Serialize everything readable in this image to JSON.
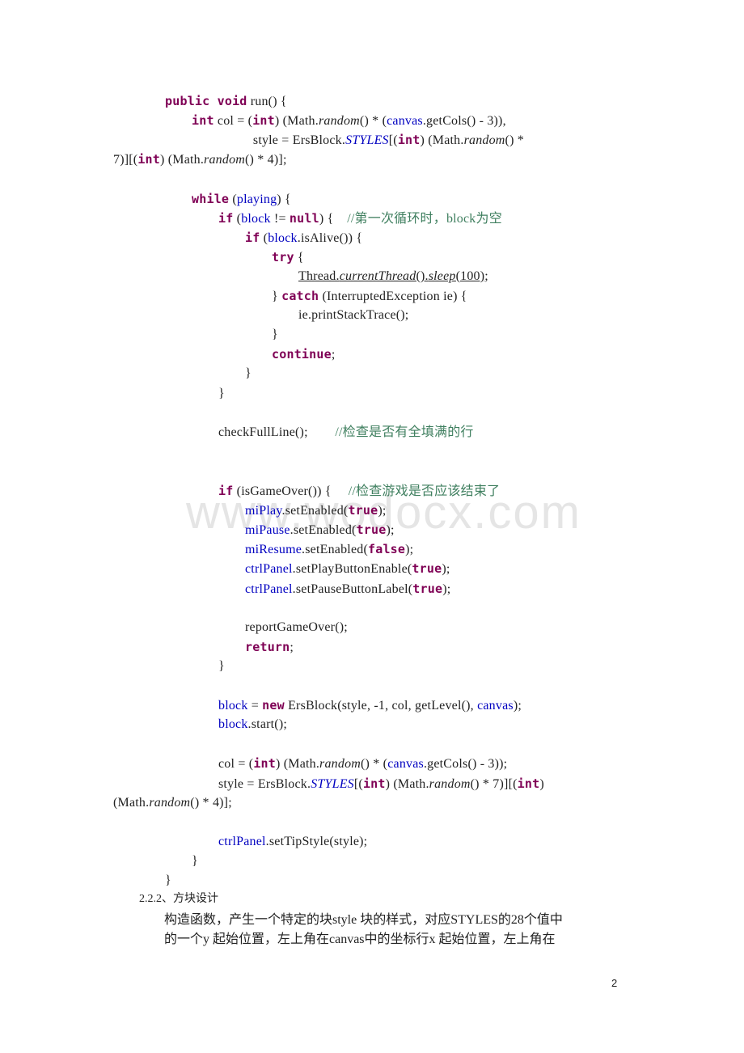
{
  "document": {
    "code_lines": [
      {
        "indent": 0,
        "parts": [
          [
            "kw",
            "public void"
          ],
          [
            "t",
            " run() {"
          ]
        ]
      },
      {
        "indent": 1,
        "parts": [
          [
            "kw",
            "int"
          ],
          [
            "t",
            " col = ("
          ],
          [
            "kw",
            "int"
          ],
          [
            "t",
            ") (Math."
          ],
          [
            "it",
            "random"
          ],
          [
            "t",
            "() * ("
          ],
          [
            "fld",
            "canvas"
          ],
          [
            "t",
            ".getCols() - 3)),"
          ]
        ]
      },
      {
        "indent": 3.3,
        "parts": [
          [
            "t",
            "style = ErsBlock."
          ],
          [
            "sfld",
            "STYLES"
          ],
          [
            "t",
            "[("
          ],
          [
            "kw",
            "int"
          ],
          [
            "t",
            ") (Math."
          ],
          [
            "it",
            "random"
          ],
          [
            "t",
            "() *"
          ]
        ]
      },
      {
        "indent": -1,
        "parts": [
          [
            "t",
            "7)][("
          ],
          [
            "kw",
            "int"
          ],
          [
            "t",
            ") (Math."
          ],
          [
            "it",
            "random"
          ],
          [
            "t",
            "() * 4)];"
          ]
        ]
      },
      {
        "indent": 0,
        "parts": []
      },
      {
        "indent": 1,
        "parts": [
          [
            "kw",
            "while"
          ],
          [
            "t",
            " ("
          ],
          [
            "fld",
            "playing"
          ],
          [
            "t",
            ") {"
          ]
        ]
      },
      {
        "indent": 2,
        "parts": [
          [
            "kw",
            "if"
          ],
          [
            "t",
            " ("
          ],
          [
            "fld",
            "block"
          ],
          [
            "t",
            " != "
          ],
          [
            "kw",
            "null"
          ],
          [
            "t",
            ") {    "
          ],
          [
            "cm",
            "//第一次循环时，block为空"
          ]
        ]
      },
      {
        "indent": 3,
        "parts": [
          [
            "kw",
            "if"
          ],
          [
            "t",
            " ("
          ],
          [
            "fld",
            "block"
          ],
          [
            "t",
            ".isAlive()) {"
          ]
        ]
      },
      {
        "indent": 4,
        "parts": [
          [
            "kw",
            "try"
          ],
          [
            "t",
            " {"
          ]
        ]
      },
      {
        "indent": 5,
        "parts": [
          [
            "ul",
            "Thread."
          ],
          [
            "ul-it",
            "currentThread"
          ],
          [
            "ul",
            "()."
          ],
          [
            "ul-it",
            "sleep"
          ],
          [
            "ul",
            "(100)"
          ],
          [
            "t",
            ";"
          ]
        ]
      },
      {
        "indent": 4,
        "parts": [
          [
            "t",
            "} "
          ],
          [
            "kw",
            "catch"
          ],
          [
            "t",
            " (InterruptedException ie) {"
          ]
        ]
      },
      {
        "indent": 5,
        "parts": [
          [
            "t",
            "ie.printStackTrace();"
          ]
        ]
      },
      {
        "indent": 4,
        "parts": [
          [
            "t",
            "}"
          ]
        ]
      },
      {
        "indent": 4,
        "parts": [
          [
            "kw",
            "continue"
          ],
          [
            "t",
            ";"
          ]
        ]
      },
      {
        "indent": 3,
        "parts": [
          [
            "t",
            "}"
          ]
        ]
      },
      {
        "indent": 2,
        "parts": [
          [
            "t",
            "}"
          ]
        ]
      },
      {
        "indent": 0,
        "parts": []
      },
      {
        "indent": 2,
        "parts": [
          [
            "t",
            "checkFullLine();        "
          ],
          [
            "cm",
            "//检查是否有全填满的行"
          ]
        ]
      },
      {
        "indent": 0,
        "parts": []
      },
      {
        "indent": 0,
        "parts": []
      },
      {
        "indent": 2,
        "parts": [
          [
            "kw",
            "if"
          ],
          [
            "t",
            " (isGameOver()) {     "
          ],
          [
            "cm",
            "//检查游戏是否应该结束了"
          ]
        ]
      },
      {
        "indent": 3,
        "parts": [
          [
            "fld",
            "miPlay"
          ],
          [
            "t",
            ".setEnabled("
          ],
          [
            "kw",
            "true"
          ],
          [
            "t",
            ");"
          ]
        ]
      },
      {
        "indent": 3,
        "parts": [
          [
            "fld",
            "miPause"
          ],
          [
            "t",
            ".setEnabled("
          ],
          [
            "kw",
            "true"
          ],
          [
            "t",
            ");"
          ]
        ]
      },
      {
        "indent": 3,
        "parts": [
          [
            "fld",
            "miResume"
          ],
          [
            "t",
            ".setEnabled("
          ],
          [
            "kw",
            "false"
          ],
          [
            "t",
            ");"
          ]
        ]
      },
      {
        "indent": 3,
        "parts": [
          [
            "fld",
            "ctrlPanel"
          ],
          [
            "t",
            ".setPlayButtonEnable("
          ],
          [
            "kw",
            "true"
          ],
          [
            "t",
            ");"
          ]
        ]
      },
      {
        "indent": 3,
        "parts": [
          [
            "fld",
            "ctrlPanel"
          ],
          [
            "t",
            ".setPauseButtonLabel("
          ],
          [
            "kw",
            "true"
          ],
          [
            "t",
            ");"
          ]
        ]
      },
      {
        "indent": 0,
        "parts": []
      },
      {
        "indent": 3,
        "parts": [
          [
            "t",
            "reportGameOver();"
          ]
        ]
      },
      {
        "indent": 3,
        "parts": [
          [
            "kw",
            "return"
          ],
          [
            "t",
            ";"
          ]
        ]
      },
      {
        "indent": 2,
        "parts": [
          [
            "t",
            "}"
          ]
        ]
      },
      {
        "indent": 0,
        "parts": []
      },
      {
        "indent": 2,
        "parts": [
          [
            "fld",
            "block"
          ],
          [
            "t",
            " = "
          ],
          [
            "kw",
            "new"
          ],
          [
            "t",
            " ErsBlock(style, -1, col, getLevel(), "
          ],
          [
            "fld",
            "canvas"
          ],
          [
            "t",
            ");"
          ]
        ]
      },
      {
        "indent": 2,
        "parts": [
          [
            "fld",
            "block"
          ],
          [
            "t",
            ".start();"
          ]
        ]
      },
      {
        "indent": 0,
        "parts": []
      },
      {
        "indent": 2,
        "parts": [
          [
            "t",
            "col = ("
          ],
          [
            "kw",
            "int"
          ],
          [
            "t",
            ") (Math."
          ],
          [
            "it",
            "random"
          ],
          [
            "t",
            "() * ("
          ],
          [
            "fld",
            "canvas"
          ],
          [
            "t",
            ".getCols() - 3));"
          ]
        ]
      },
      {
        "indent": 2,
        "parts": [
          [
            "t",
            "style = ErsBlock."
          ],
          [
            "sfld",
            "STYLES"
          ],
          [
            "t",
            "[("
          ],
          [
            "kw",
            "int"
          ],
          [
            "t",
            ") (Math."
          ],
          [
            "it",
            "random"
          ],
          [
            "t",
            "() * 7)][("
          ],
          [
            "kw",
            "int"
          ],
          [
            "t",
            ")"
          ]
        ]
      },
      {
        "indent": -1,
        "parts": [
          [
            "t",
            "(Math."
          ],
          [
            "it",
            "random"
          ],
          [
            "t",
            "() * 4)];"
          ]
        ]
      },
      {
        "indent": 0,
        "parts": []
      },
      {
        "indent": 2,
        "parts": [
          [
            "fld",
            "ctrlPanel"
          ],
          [
            "t",
            ".setTipStyle(style);"
          ]
        ]
      },
      {
        "indent": 1,
        "parts": [
          [
            "t",
            "}"
          ]
        ]
      },
      {
        "indent": 0,
        "parts": [
          [
            "t",
            "}"
          ]
        ]
      }
    ],
    "section_heading": "2.2.2、方块设计",
    "paragraph_lines": [
      "构造函数，产生一个特定的块style 块的样式，对应STYLES的28个值中",
      "的一个y 起始位置，左上角在canvas中的坐标行x 起始位置，左上角在"
    ],
    "watermark": "www.wodocx.com",
    "page_number": "2"
  }
}
